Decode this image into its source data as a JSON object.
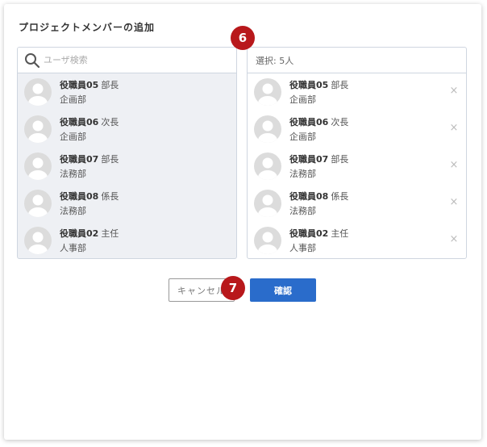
{
  "dialog": {
    "title": "プロジェクトメンバーの追加"
  },
  "search": {
    "placeholder": "ユーザ検索"
  },
  "available_users": [
    {
      "name": "役職員05",
      "role": "部長",
      "dept": "企画部"
    },
    {
      "name": "役職員06",
      "role": "次長",
      "dept": "企画部"
    },
    {
      "name": "役職員07",
      "role": "部長",
      "dept": "法務部"
    },
    {
      "name": "役職員08",
      "role": "係長",
      "dept": "法務部"
    },
    {
      "name": "役職員02",
      "role": "主任",
      "dept": "人事部"
    }
  ],
  "selected": {
    "header": "選択: 5人",
    "users": [
      {
        "name": "役職員05",
        "role": "部長",
        "dept": "企画部",
        "remove": "×"
      },
      {
        "name": "役職員06",
        "role": "次長",
        "dept": "企画部",
        "remove": "×"
      },
      {
        "name": "役職員07",
        "role": "部長",
        "dept": "法務部",
        "remove": "×"
      },
      {
        "name": "役職員08",
        "role": "係長",
        "dept": "法務部",
        "remove": "×"
      },
      {
        "name": "役職員02",
        "role": "主任",
        "dept": "人事部",
        "remove": "×"
      }
    ]
  },
  "buttons": {
    "cancel": "キャンセル",
    "confirm": "確認"
  },
  "markers": {
    "m6": "6",
    "m7": "7"
  },
  "colors": {
    "primary": "#2a6ccb",
    "marker": "#b8181b",
    "list_bg": "#eef0f4"
  }
}
